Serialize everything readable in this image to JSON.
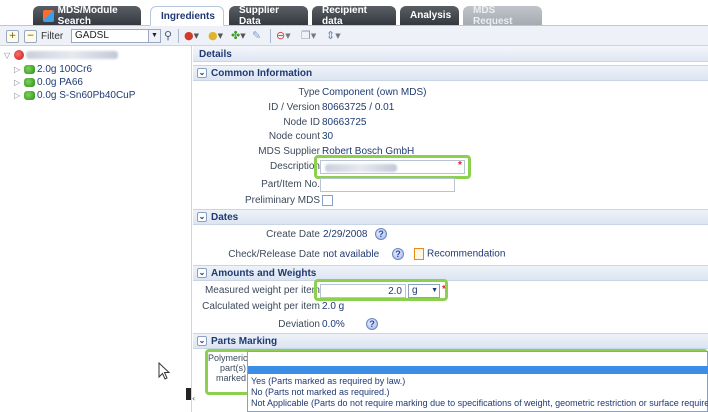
{
  "tabs": [
    {
      "label": "MDS/Module Search"
    },
    {
      "label": "Ingredients"
    },
    {
      "label": "Supplier Data"
    },
    {
      "label": "Recipient data"
    },
    {
      "label": "Analysis"
    },
    {
      "label": "MDS Request"
    }
  ],
  "toolbar": {
    "filter_label": "Filter",
    "filter_value": "GADSL"
  },
  "tree": {
    "items": [
      {
        "weight": "2.0g",
        "name": "100Cr6"
      },
      {
        "weight": "0.0g",
        "name": "PA66"
      },
      {
        "weight": "0.0g",
        "name": "S-Sn60Pb40CuP"
      }
    ]
  },
  "details": {
    "title": "Details",
    "common": {
      "header": "Common Information",
      "type_label": "Type",
      "type_value": "Component (own MDS)",
      "id_label": "ID / Version",
      "id_value": "80663725 / 0.01",
      "node_id_label": "Node ID",
      "node_id_value": "80663725",
      "node_count_label": "Node count",
      "node_count_value": "30",
      "supplier_label": "MDS Supplier",
      "supplier_value": "Robert Bosch GmbH",
      "description_label": "Description",
      "part_no_label": "Part/Item No.",
      "preliminary_label": "Preliminary MDS"
    },
    "dates": {
      "header": "Dates",
      "create_label": "Create Date",
      "create_value": "2/29/2008",
      "release_label": "Check/Release Date",
      "release_value": "not available",
      "recommendation": "Recommendation"
    },
    "amounts": {
      "header": "Amounts and Weights",
      "measured_label": "Measured weight per item",
      "measured_value": "2.0",
      "measured_unit": "g",
      "calculated_label": "Calculated weight per item",
      "calculated_value": "2.0  g",
      "deviation_label": "Deviation",
      "deviation_value": "0.0%"
    },
    "marking": {
      "header": "Parts Marking",
      "field_label": "Polymeric part(s) marked",
      "options": [
        "Yes (Parts marked as required by law.)",
        "No (Parts not marked as required.)",
        "Not Applicable (Parts do not require marking due to specifications of weight, geometric restriction or surface requirements."
      ]
    }
  },
  "colors": {
    "highlight": "#8bd04f",
    "selection": "#3a8ee6",
    "text": "#1f3a73"
  }
}
